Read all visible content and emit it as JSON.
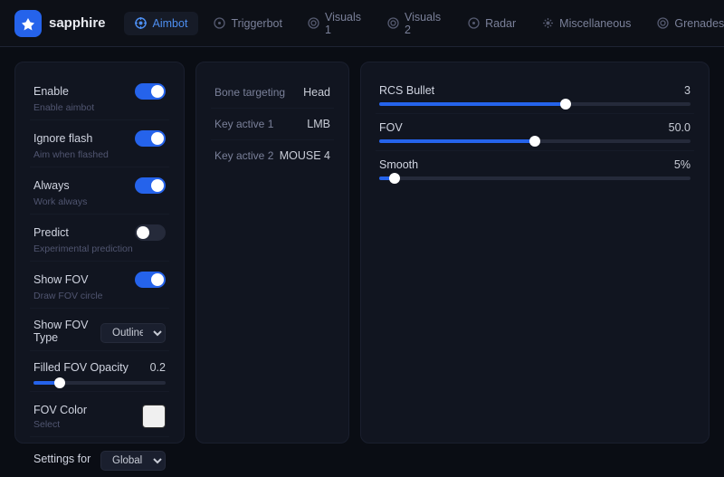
{
  "app": {
    "logo_text": "sapphire",
    "logo_icon": "◆"
  },
  "nav": {
    "items": [
      {
        "id": "aimbot",
        "label": "Aimbot",
        "icon": "⊕",
        "active": true
      },
      {
        "id": "triggerbot",
        "label": "Triggerbot",
        "icon": "◎"
      },
      {
        "id": "visuals1",
        "label": "Visuals 1",
        "icon": "◉"
      },
      {
        "id": "visuals2",
        "label": "Visuals 2",
        "icon": "◉"
      },
      {
        "id": "radar",
        "label": "Radar",
        "icon": "◎"
      },
      {
        "id": "miscellaneous",
        "label": "Miscellaneous",
        "icon": "⚙"
      },
      {
        "id": "grenades",
        "label": "Grenades",
        "icon": "◎"
      }
    ]
  },
  "left_panel": {
    "settings": [
      {
        "id": "enable",
        "label": "Enable",
        "sub": "Enable aimbot",
        "type": "toggle",
        "on": true
      },
      {
        "id": "ignore_flash",
        "label": "Ignore flash",
        "sub": "Aim when flashed",
        "type": "toggle",
        "on": true
      },
      {
        "id": "always",
        "label": "Always",
        "sub": "Work always",
        "type": "toggle",
        "on": true
      },
      {
        "id": "predict",
        "label": "Predict",
        "sub": "Experimental prediction",
        "type": "toggle",
        "on": false
      },
      {
        "id": "show_fov",
        "label": "Show FOV",
        "sub": "Draw FOV circle",
        "type": "toggle",
        "on": true
      },
      {
        "id": "show_fov_type",
        "label": "Show FOV Type",
        "type": "dropdown",
        "value": "Outline"
      },
      {
        "id": "filled_fov_opacity",
        "label": "Filled FOV Opacity",
        "type": "slider",
        "value": "0.2",
        "percent": 20
      },
      {
        "id": "fov_color",
        "label": "FOV Color",
        "sub": "Select",
        "type": "color"
      },
      {
        "id": "settings_for",
        "label": "Settings for",
        "type": "dropdown",
        "value": "Global"
      }
    ]
  },
  "middle_panel": {
    "rows": [
      {
        "id": "bone_targeting",
        "label": "Bone targeting",
        "value": "Head"
      },
      {
        "id": "key_active_1",
        "label": "Key active 1",
        "value": "LMB"
      },
      {
        "id": "key_active_2",
        "label": "Key active 2",
        "value": "MOUSE 4"
      }
    ]
  },
  "right_panel": {
    "sliders": [
      {
        "id": "rcs_bullet",
        "label": "RCS Bullet",
        "value": "3",
        "percent": 60
      },
      {
        "id": "fov",
        "label": "FOV",
        "value": "50.0",
        "percent": 50
      },
      {
        "id": "smooth",
        "label": "Smooth",
        "value": "5%",
        "percent": 5
      }
    ]
  }
}
